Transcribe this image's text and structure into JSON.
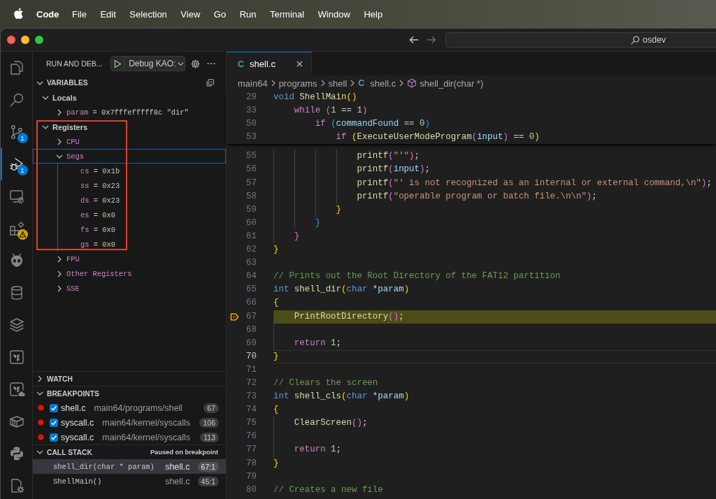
{
  "menu_bar": {
    "app_name": "Code",
    "menus": [
      "File",
      "Edit",
      "Selection",
      "View",
      "Go",
      "Run",
      "Terminal",
      "Window",
      "Help"
    ]
  },
  "title_bar": {
    "navigation": [
      {
        "kind": "back",
        "disabled": false
      },
      {
        "kind": "forward",
        "disabled": true
      }
    ],
    "command_center": {
      "label": "osdev"
    }
  },
  "activity_bar": {
    "items": [
      {
        "kind": "files",
        "selected": false,
        "warning": false
      },
      {
        "kind": "search",
        "selected": false,
        "warning": false
      },
      {
        "kind": "branch",
        "selected": false,
        "warning": false,
        "badge": "1"
      },
      {
        "kind": "debug",
        "selected": true,
        "warning": false,
        "badge": "1"
      },
      {
        "kind": "remote",
        "selected": false,
        "warning": false
      },
      {
        "kind": "extensions",
        "selected": false,
        "warning": true
      },
      {
        "kind": "alien",
        "selected": false,
        "warning": false
      },
      {
        "kind": "database",
        "selected": false,
        "warning": false
      },
      {
        "kind": "layers",
        "selected": false,
        "warning": false
      },
      {
        "kind": "tile",
        "selected": false,
        "warning": false
      },
      {
        "kind": "tile-cloud",
        "selected": false,
        "warning": false
      },
      {
        "kind": "container",
        "selected": false,
        "warning": false
      },
      {
        "kind": "snakes",
        "selected": false,
        "warning": false
      },
      {
        "kind": "file-gear",
        "selected": false,
        "warning": false
      }
    ]
  },
  "sidebar": {
    "title": "RUN AND DEB...",
    "debug_config": {
      "label": "Debug KAO:"
    },
    "variables": {
      "title": "VARIABLES",
      "expanded": true,
      "scopes": [
        {
          "label": "Locals",
          "expanded": true,
          "outlined": false,
          "children": [
            {
              "name": "param",
              "separator": " = ",
              "value": "0x7fffefffff8c \"dir\"",
              "kind": "pointer",
              "expanded": false,
              "focused": false
            }
          ]
        },
        {
          "label": "Registers",
          "expanded": true,
          "outlined": true,
          "children": [
            {
              "label": "CPU",
              "expanded": false,
              "focused": false
            },
            {
              "label": "Segs",
              "expanded": true,
              "focused": true,
              "children": [
                {
                  "name": "cs",
                  "separator": " = ",
                  "value": "0x1b",
                  "kind": "number"
                },
                {
                  "name": "ss",
                  "separator": " = ",
                  "value": "0x23",
                  "kind": "number"
                },
                {
                  "name": "ds",
                  "separator": " = ",
                  "value": "0x23",
                  "kind": "number"
                },
                {
                  "name": "es",
                  "separator": " = ",
                  "value": "0x0",
                  "kind": "number"
                },
                {
                  "name": "fs",
                  "separator": " = ",
                  "value": "0x0",
                  "kind": "number"
                },
                {
                  "name": "gs",
                  "separator": " = ",
                  "value": "0x0",
                  "kind": "number"
                }
              ]
            },
            {
              "label": "FPU",
              "expanded": false,
              "focused": false
            },
            {
              "label": "Other Registers",
              "expanded": false,
              "focused": false
            },
            {
              "label": "SSE",
              "expanded": false,
              "focused": false
            }
          ]
        }
      ]
    },
    "watch": {
      "title": "WATCH",
      "expanded": false
    },
    "breakpoints": {
      "title": "BREAKPOINTS",
      "expanded": true,
      "items": [
        {
          "file": "shell.c",
          "path": "main64/programs/shell",
          "line": "67",
          "checked": true
        },
        {
          "file": "syscall.c",
          "path": "main64/kernel/syscalls",
          "line": "106",
          "checked": true
        },
        {
          "file": "syscall.c",
          "path": "main64/kernel/syscalls",
          "line": "113",
          "checked": true
        }
      ]
    },
    "call_stack": {
      "title": "CALL STACK",
      "expanded": true,
      "status": "Paused on breakpoint",
      "frames": [
        {
          "name": "shell_dir(char * param)",
          "file": "shell.c",
          "position": "67:1",
          "selected": true
        },
        {
          "name": "ShellMain()",
          "file": "shell.c",
          "position": "45:1",
          "selected": false
        }
      ]
    }
  },
  "editor": {
    "tabs": [
      {
        "file_icon": "C",
        "label": "shell.c",
        "selected": true
      }
    ],
    "breadcrumbs": [
      {
        "label": "main64",
        "kind": "folder"
      },
      {
        "label": "programs",
        "kind": "folder"
      },
      {
        "label": "shell",
        "kind": "folder"
      },
      {
        "label": "shell.c",
        "kind": "file",
        "file_icon": "C"
      },
      {
        "label": "shell_dir(char *)",
        "kind": "symbol"
      }
    ],
    "sticky_lines": [
      {
        "number": "29",
        "tokens": [
          {
            "text": "void ",
            "kind": "type"
          },
          {
            "text": "ShellMain",
            "kind": "function"
          },
          {
            "text": "()",
            "kind": "bracket1"
          }
        ]
      },
      {
        "number": "33",
        "tokens": [
          {
            "text": "    while ",
            "kind": "keyword"
          },
          {
            "text": "(",
            "kind": "bracket2"
          },
          {
            "text": "1",
            "kind": "number"
          },
          {
            "text": " == ",
            "kind": "plain"
          },
          {
            "text": "1",
            "kind": "number"
          },
          {
            "text": ")",
            "kind": "bracket2"
          }
        ]
      },
      {
        "number": "50",
        "tokens": [
          {
            "text": "        if ",
            "kind": "keyword"
          },
          {
            "text": "(",
            "kind": "bracket3"
          },
          {
            "text": "commandFound",
            "kind": "variable"
          },
          {
            "text": " == ",
            "kind": "plain"
          },
          {
            "text": "0",
            "kind": "number"
          },
          {
            "text": ")",
            "kind": "bracket3"
          }
        ]
      },
      {
        "number": "53",
        "tokens": [
          {
            "text": "            if ",
            "kind": "keyword"
          },
          {
            "text": "(",
            "kind": "bracket1"
          },
          {
            "text": "ExecuteUserModeProgram",
            "kind": "function"
          },
          {
            "text": "(",
            "kind": "bracket2"
          },
          {
            "text": "input",
            "kind": "variable"
          },
          {
            "text": ")",
            "kind": "bracket2"
          },
          {
            "text": " == ",
            "kind": "plain"
          },
          {
            "text": "0",
            "kind": "number"
          },
          {
            "text": ")",
            "kind": "bracket1"
          }
        ]
      }
    ],
    "lines": [
      {
        "number": "55",
        "paused": false,
        "current": false,
        "tokens": [
          {
            "text": "                printf",
            "kind": "function"
          },
          {
            "text": "(",
            "kind": "bracket2"
          },
          {
            "text": "\"'\"",
            "kind": "string"
          },
          {
            "text": ")",
            "kind": "bracket2"
          },
          {
            "text": ";",
            "kind": "plain"
          }
        ]
      },
      {
        "number": "56",
        "paused": false,
        "current": false,
        "tokens": [
          {
            "text": "                printf",
            "kind": "function"
          },
          {
            "text": "(",
            "kind": "bracket2"
          },
          {
            "text": "input",
            "kind": "variable"
          },
          {
            "text": ")",
            "kind": "bracket2"
          },
          {
            "text": ";",
            "kind": "plain"
          }
        ]
      },
      {
        "number": "57",
        "paused": false,
        "current": false,
        "tokens": [
          {
            "text": "                printf",
            "kind": "function"
          },
          {
            "text": "(",
            "kind": "bracket2"
          },
          {
            "text": "\"' is not recognized as an internal or external command,\\n\"",
            "kind": "string"
          },
          {
            "text": ")",
            "kind": "bracket2"
          },
          {
            "text": ";",
            "kind": "plain"
          }
        ]
      },
      {
        "number": "58",
        "paused": false,
        "current": false,
        "tokens": [
          {
            "text": "                printf",
            "kind": "function"
          },
          {
            "text": "(",
            "kind": "bracket2"
          },
          {
            "text": "\"operable program or batch file.\\n\\n\"",
            "kind": "string"
          },
          {
            "text": ")",
            "kind": "bracket2"
          },
          {
            "text": ";",
            "kind": "plain"
          }
        ]
      },
      {
        "number": "59",
        "paused": false,
        "current": false,
        "tokens": [
          {
            "text": "            }",
            "kind": "bracket1"
          }
        ]
      },
      {
        "number": "60",
        "paused": false,
        "current": false,
        "tokens": [
          {
            "text": "        }",
            "kind": "bracket3"
          }
        ]
      },
      {
        "number": "61",
        "paused": false,
        "current": false,
        "tokens": [
          {
            "text": "    }",
            "kind": "bracket2"
          }
        ]
      },
      {
        "number": "62",
        "paused": false,
        "current": false,
        "tokens": [
          {
            "text": "}",
            "kind": "bracket1"
          }
        ]
      },
      {
        "number": "63",
        "paused": false,
        "current": false
      },
      {
        "number": "64",
        "paused": false,
        "current": false,
        "tokens": [
          {
            "text": "// Prints out the Root Directory of the FAT12 partition",
            "kind": "comment"
          }
        ]
      },
      {
        "number": "65",
        "paused": false,
        "current": false,
        "tokens": [
          {
            "text": "int ",
            "kind": "type"
          },
          {
            "text": "shell_dir",
            "kind": "function"
          },
          {
            "text": "(",
            "kind": "bracket1"
          },
          {
            "text": "char ",
            "kind": "type"
          },
          {
            "text": "*",
            "kind": "plain"
          },
          {
            "text": "param",
            "kind": "variable"
          },
          {
            "text": ")",
            "kind": "bracket1"
          }
        ]
      },
      {
        "number": "66",
        "paused": false,
        "current": false,
        "tokens": [
          {
            "text": "{",
            "kind": "bracket1"
          }
        ]
      },
      {
        "number": "67",
        "paused": true,
        "current": false,
        "tokens": [
          {
            "text": "    PrintRootDirectory",
            "kind": "function"
          },
          {
            "text": "()",
            "kind": "bracket2"
          },
          {
            "text": ";",
            "kind": "plain"
          }
        ]
      },
      {
        "number": "68",
        "paused": false,
        "current": false
      },
      {
        "number": "69",
        "paused": false,
        "current": false,
        "tokens": [
          {
            "text": "    return ",
            "kind": "keyword"
          },
          {
            "text": "1",
            "kind": "number"
          },
          {
            "text": ";",
            "kind": "plain"
          }
        ]
      },
      {
        "number": "70",
        "paused": false,
        "current": true,
        "tokens": [
          {
            "text": "}",
            "kind": "bracket1"
          }
        ]
      },
      {
        "number": "71",
        "paused": false,
        "current": false
      },
      {
        "number": "72",
        "paused": false,
        "current": false,
        "tokens": [
          {
            "text": "// Clears the screen",
            "kind": "comment"
          }
        ]
      },
      {
        "number": "73",
        "paused": false,
        "current": false,
        "tokens": [
          {
            "text": "int ",
            "kind": "type"
          },
          {
            "text": "shell_cls",
            "kind": "function"
          },
          {
            "text": "(",
            "kind": "bracket1"
          },
          {
            "text": "char ",
            "kind": "type"
          },
          {
            "text": "*",
            "kind": "plain"
          },
          {
            "text": "param",
            "kind": "variable"
          },
          {
            "text": ")",
            "kind": "bracket1"
          }
        ]
      },
      {
        "number": "74",
        "paused": false,
        "current": false,
        "tokens": [
          {
            "text": "{",
            "kind": "bracket1"
          }
        ]
      },
      {
        "number": "75",
        "paused": false,
        "current": false,
        "tokens": [
          {
            "text": "    ClearScreen",
            "kind": "function"
          },
          {
            "text": "()",
            "kind": "bracket2"
          },
          {
            "text": ";",
            "kind": "plain"
          }
        ]
      },
      {
        "number": "76",
        "paused": false,
        "current": false
      },
      {
        "number": "77",
        "paused": false,
        "current": false,
        "tokens": [
          {
            "text": "    return ",
            "kind": "keyword"
          },
          {
            "text": "1",
            "kind": "number"
          },
          {
            "text": ";",
            "kind": "plain"
          }
        ]
      },
      {
        "number": "78",
        "paused": false,
        "current": false,
        "tokens": [
          {
            "text": "}",
            "kind": "bracket1"
          }
        ]
      },
      {
        "number": "79",
        "paused": false,
        "current": false
      },
      {
        "number": "80",
        "paused": false,
        "current": false,
        "tokens": [
          {
            "text": "// Creates a new file",
            "kind": "comment"
          }
        ]
      }
    ]
  }
}
